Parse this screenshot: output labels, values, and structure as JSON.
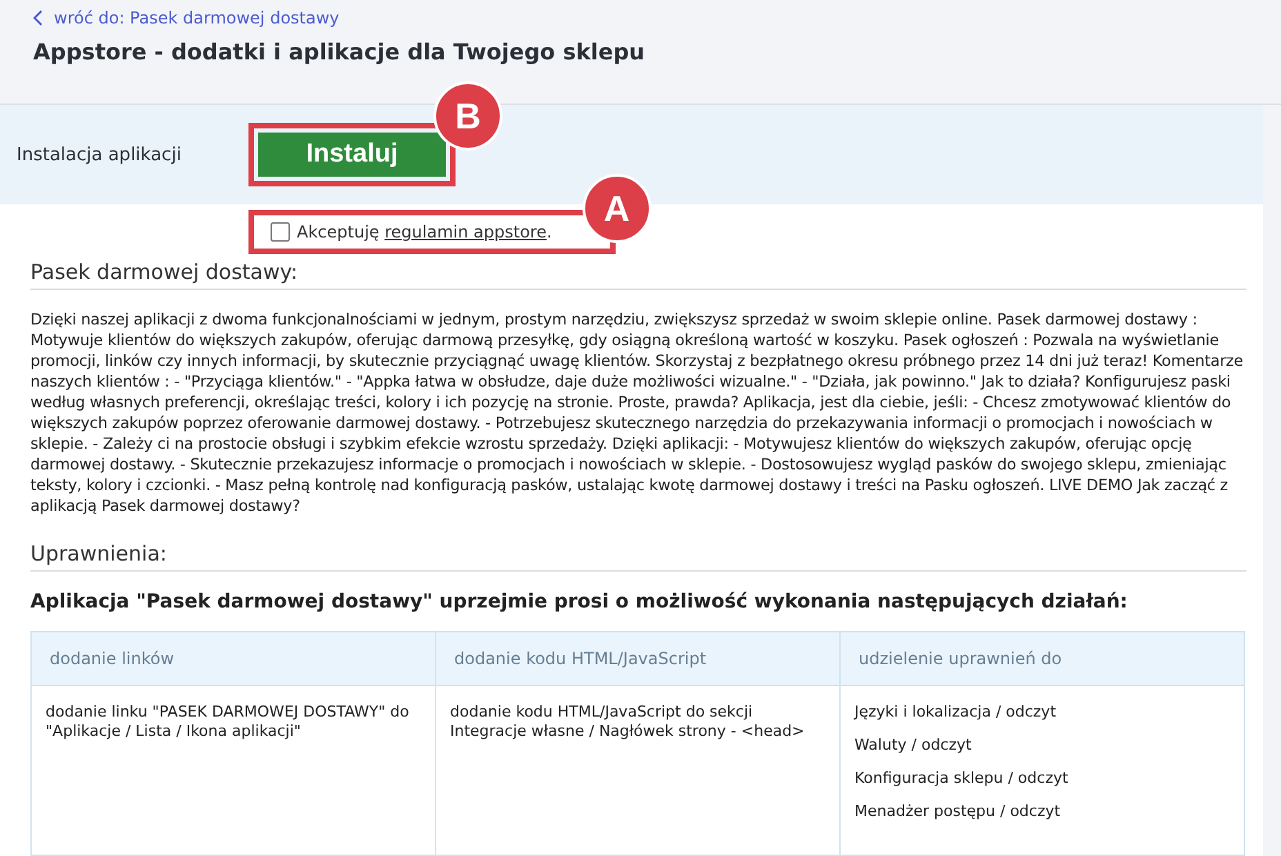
{
  "header": {
    "back_link": "wróć do: Pasek darmowej dostawy",
    "title": "Appstore - dodatki i aplikacje dla Twojego sklepu"
  },
  "install": {
    "label": "Instalacja aplikacji",
    "button": "Instaluj",
    "annotation": "B"
  },
  "terms": {
    "checked": false,
    "text": "Akceptuję",
    "link": "regulamin appstore",
    "suffix": ".",
    "annotation": "A"
  },
  "description": {
    "heading": "Pasek darmowej dostawy:",
    "text": "Dzięki naszej aplikacji z dwoma funkcjonalnościami w jednym, prostym narzędziu, zwiększysz sprzedaż w swoim sklepie online. Pasek darmowej dostawy : Motywuje klientów do większych zakupów, oferując darmową przesyłkę, gdy osiągną określoną wartość w koszyku. Pasek ogłoszeń : Pozwala na wyświetlanie promocji, linków czy innych informacji, by skutecznie przyciągnąć uwagę klientów. Skorzystaj z bezpłatnego okresu próbnego przez 14 dni już teraz! Komentarze naszych klientów : - \"Przyciąga klientów.\" - \"Appka łatwa w obsłudze, daje duże możliwości wizualne.\" - \"Działa, jak powinno.\" Jak to działa? Konfigurujesz paski według własnych preferencji, określając treści, kolory i ich pozycję na stronie. Proste, prawda? Aplikacja, jest dla ciebie, jeśli: - Chcesz zmotywować klientów do większych zakupów poprzez oferowanie darmowej dostawy. - Potrzebujesz skutecznego narzędzia do przekazywania informacji o promocjach i nowościach w sklepie. - Zależy ci na prostocie obsługi i szybkim efekcie wzrostu sprzedaży. Dzięki aplikacji: - Motywujesz klientów do większych zakupów, oferując opcję darmowej dostawy. - Skutecznie przekazujesz informacje o promocjach i nowościach w sklepie. - Dostosowujesz wygląd pasków do swojego sklepu, zmieniając teksty, kolory i czcionki. - Masz pełną kontrolę nad konfiguracją pasków, ustalając kwotę darmowej dostawy i treści na Pasku ogłoszeń. LIVE DEMO Jak zacząć z aplikacją Pasek darmowej dostawy?"
  },
  "permissions": {
    "heading": "Uprawnienia:",
    "request": "Aplikacja \"Pasek darmowej dostawy\" uprzejmie prosi o możliwość wykonania następujących działań:",
    "table": {
      "columns": [
        "dodanie linków",
        "dodanie kodu HTML/JavaScript",
        "udzielenie uprawnień do"
      ],
      "rows": [
        [
          [
            "dodanie linku \"PASEK DARMOWEJ DOSTAWY\" do \"Aplikacje / Lista / Ikona aplikacji\""
          ],
          [
            "dodanie kodu HTML/JavaScript do sekcji Integracje własne / Nagłówek strony - <head>"
          ],
          [
            "Języki i lokalizacja / odczyt",
            "Waluty / odczyt",
            "Konfiguracja sklepu / odczyt",
            "Menadżer postępu / odczyt"
          ]
        ]
      ]
    }
  }
}
